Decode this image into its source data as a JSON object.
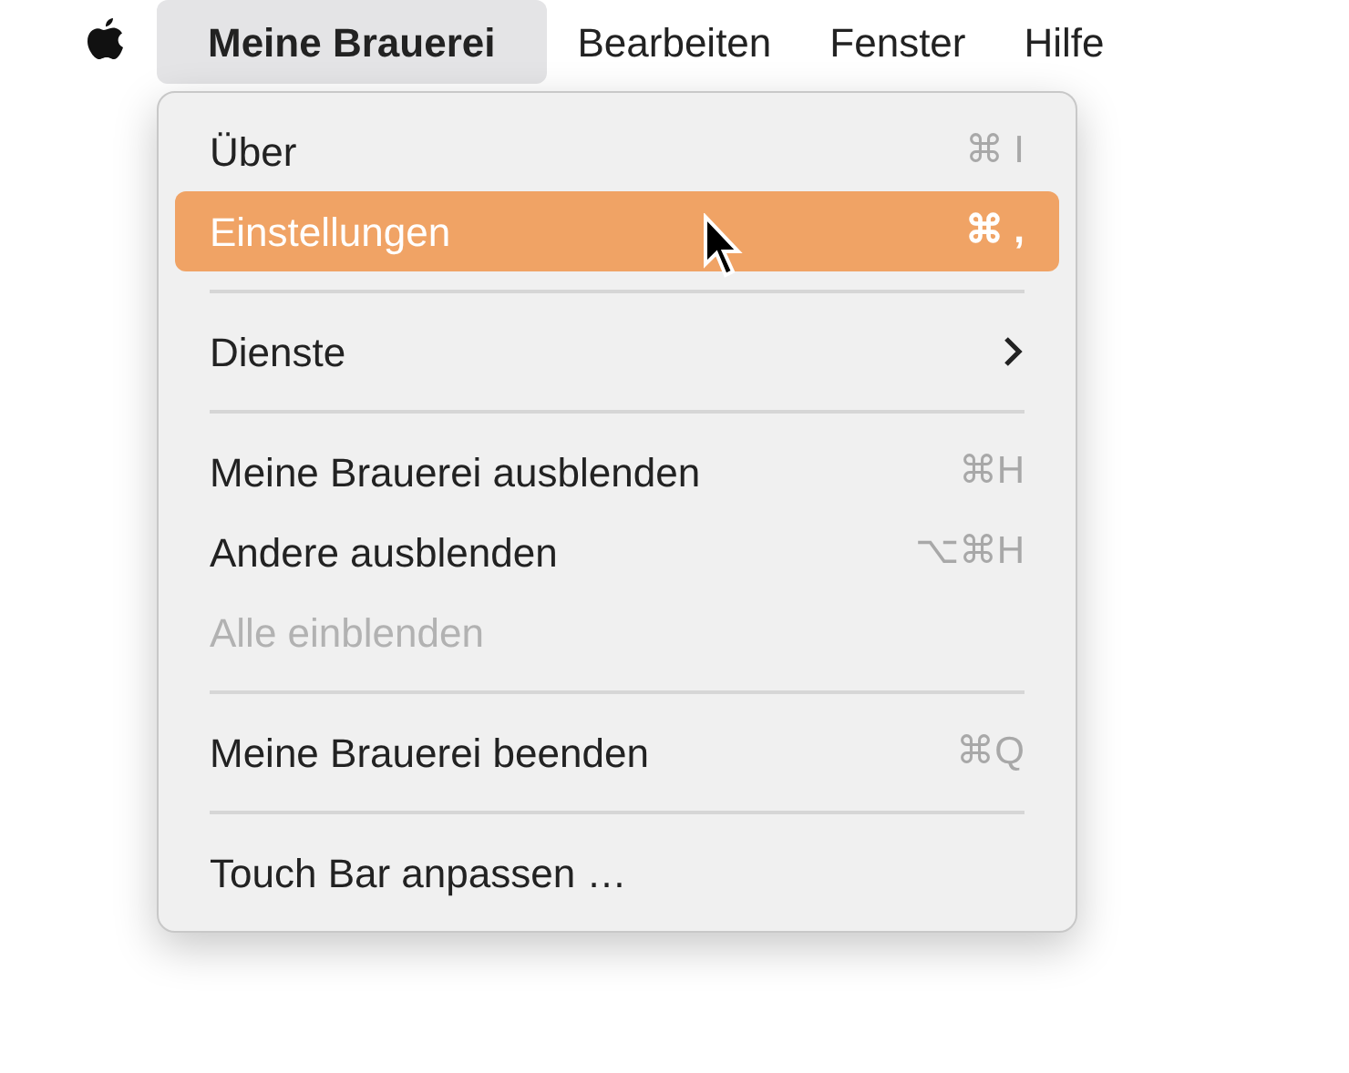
{
  "menu_bar": [
    {
      "label": "Meine Brauerei",
      "selected": true
    },
    {
      "label": "Bearbeiten",
      "selected": false
    },
    {
      "label": "Fenster",
      "selected": false
    },
    {
      "label": "Hilfe",
      "selected": false
    }
  ],
  "menu": {
    "items": [
      {
        "kind": "item",
        "label": "Über",
        "shortcut": "⌘ I",
        "selected": false,
        "disabled": false
      },
      {
        "kind": "item",
        "label": "Einstellungen",
        "shortcut": "⌘ ,",
        "selected": true,
        "disabled": false
      },
      {
        "kind": "separator"
      },
      {
        "kind": "submenu",
        "label": "Dienste",
        "selected": false,
        "disabled": false
      },
      {
        "kind": "separator"
      },
      {
        "kind": "item",
        "label": "Meine Brauerei ausblenden",
        "shortcut": "⌘H",
        "selected": false,
        "disabled": false
      },
      {
        "kind": "item",
        "label": "Andere ausblenden",
        "shortcut": "⌥⌘H",
        "selected": false,
        "disabled": false
      },
      {
        "kind": "item",
        "label": "Alle einblenden",
        "selected": false,
        "disabled": true
      },
      {
        "kind": "separator"
      },
      {
        "kind": "item",
        "label": "Meine Brauerei beenden",
        "shortcut": "⌘Q",
        "selected": false,
        "disabled": false
      },
      {
        "kind": "separator"
      },
      {
        "kind": "item",
        "label": "Touch Bar anpassen …",
        "selected": false,
        "disabled": false
      }
    ]
  }
}
